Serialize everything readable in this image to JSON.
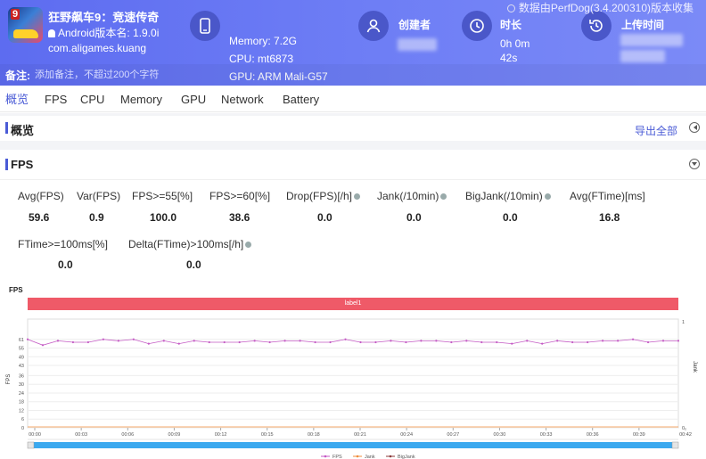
{
  "header": {
    "app_title": "狂野飙车9：竞速传奇",
    "app_package": "Android版本名: 1.9.0i com.aligames.kuang",
    "icon_number": "9",
    "memory": "Memory: 7.2G",
    "cpu": "CPU: mt6873",
    "gpu": "GPU: ARM Mali-G57",
    "creator_label": "创建者",
    "duration_label": "时长",
    "duration_value_1": "0h 0m",
    "duration_value_2": "42s",
    "upload_label": "上传时间",
    "source_note": "数据由PerfDog(3.4.200310)版本收集",
    "remark_label": "备注:",
    "remark_placeholder": "添加备注，不超过200个字符"
  },
  "nav": {
    "tabs": [
      {
        "label": "概览",
        "active": true
      },
      {
        "label": "FPS"
      },
      {
        "label": "CPU"
      },
      {
        "label": "Memory"
      },
      {
        "label": "GPU"
      },
      {
        "label": "Network"
      },
      {
        "label": "Battery"
      }
    ]
  },
  "overview": {
    "title": "概览",
    "export_label": "导出全部"
  },
  "fps_section": {
    "title": "FPS",
    "metrics": [
      {
        "label": "Avg(FPS)",
        "value": "59.6"
      },
      {
        "label": "Var(FPS)",
        "value": "0.9"
      },
      {
        "label": "FPS>=55[%]",
        "value": "100.0"
      },
      {
        "label": "FPS>=60[%]",
        "value": "38.6"
      },
      {
        "label": "Drop(FPS)[/h]",
        "value": "0.0"
      },
      {
        "label": "Jank(/10min)",
        "value": "0.0"
      },
      {
        "label": "BigJank(/10min)",
        "value": "0.0"
      },
      {
        "label": "Avg(FTime)[ms]",
        "value": "16.8"
      },
      {
        "label": "FTime>=100ms[%]",
        "value": "0.0"
      },
      {
        "label": "Delta(FTime)>100ms[/h]",
        "value": "0.0"
      }
    ]
  },
  "colors": {
    "accent": "#4a5bd6",
    "fps_line": "#c45ac4",
    "jank": "#f08c3a",
    "bigjank": "#8b3a3a",
    "label_bar": "#ef5a68",
    "scrollbar": "#3ba9ef"
  },
  "chart_data": {
    "type": "line",
    "title": "FPS",
    "band_label": "label1",
    "ylabel_left": "FPS",
    "ylabel_right": "Jank",
    "y_ticks": [
      0,
      6,
      12,
      18,
      24,
      30,
      36,
      43,
      49,
      55,
      61
    ],
    "ylim": [
      0,
      67
    ],
    "y2_ticks": [
      0,
      1
    ],
    "x_ticks": [
      "00:00",
      "00:03",
      "00:06",
      "00:09",
      "00:12",
      "00:15",
      "00:18",
      "00:21",
      "00:24",
      "00:27",
      "00:30",
      "00:33",
      "00:36",
      "00:39",
      "00:42"
    ],
    "x_seconds": [
      0,
      1,
      2,
      3,
      4,
      5,
      6,
      7,
      8,
      9,
      10,
      11,
      12,
      13,
      14,
      15,
      16,
      17,
      18,
      19,
      20,
      21,
      22,
      23,
      24,
      25,
      26,
      27,
      28,
      29,
      30,
      31,
      32,
      33,
      34,
      35,
      36,
      37,
      38,
      39,
      40,
      41,
      42
    ],
    "series": [
      {
        "name": "FPS",
        "values": [
          61,
          57,
          60,
          59,
          59,
          61,
          60,
          61,
          58,
          60,
          58,
          60,
          59,
          59,
          59,
          60,
          59,
          60,
          60,
          59,
          59,
          61,
          59,
          59,
          60,
          59,
          60,
          60,
          59,
          60,
          59,
          59,
          58,
          60,
          58,
          60,
          59,
          59,
          60,
          60,
          61,
          59,
          60,
          60
        ]
      },
      {
        "name": "Jank",
        "values": [
          0,
          0,
          0,
          0,
          0,
          0,
          0,
          0,
          0,
          0,
          0,
          0,
          0,
          0,
          0,
          0,
          0,
          0,
          0,
          0,
          0,
          0,
          0,
          0,
          0,
          0,
          0,
          0,
          0,
          0,
          0,
          0,
          0,
          0,
          0,
          0,
          0,
          0,
          0,
          0,
          0,
          0,
          0
        ]
      },
      {
        "name": "BigJank",
        "values": [
          0,
          0,
          0,
          0,
          0,
          0,
          0,
          0,
          0,
          0,
          0,
          0,
          0,
          0,
          0,
          0,
          0,
          0,
          0,
          0,
          0,
          0,
          0,
          0,
          0,
          0,
          0,
          0,
          0,
          0,
          0,
          0,
          0,
          0,
          0,
          0,
          0,
          0,
          0,
          0,
          0,
          0,
          0
        ]
      }
    ],
    "legend": [
      "FPS",
      "Jank",
      "BigJank"
    ],
    "legend_position": "bottom"
  }
}
